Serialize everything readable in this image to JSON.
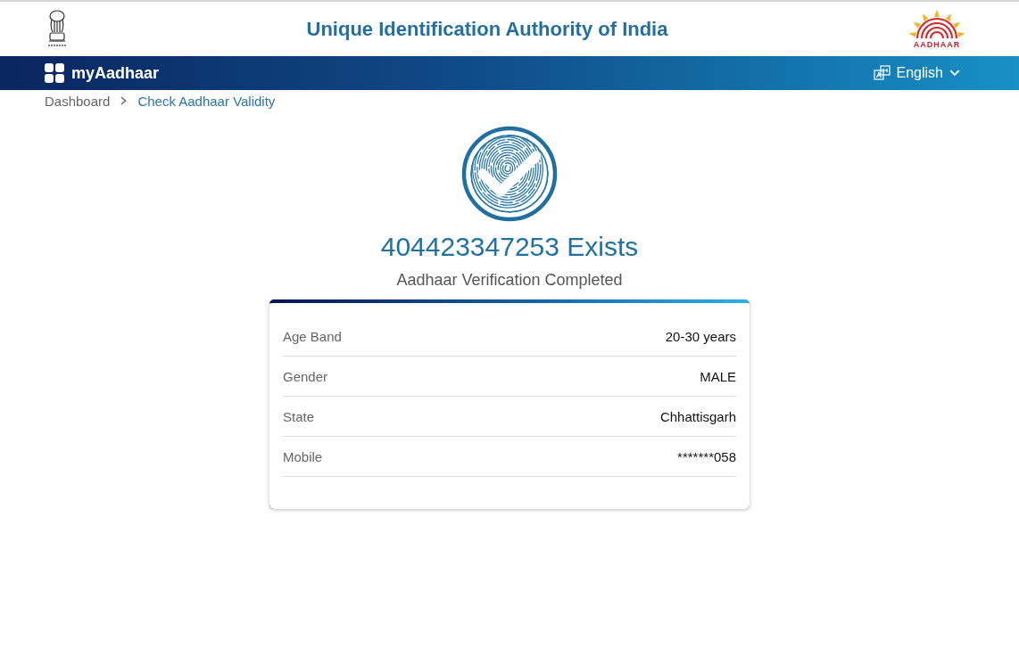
{
  "header": {
    "title": "Unique Identification Authority of India",
    "logo_text": "AADHAAR"
  },
  "navbar": {
    "brand": "myAadhaar",
    "language": "English"
  },
  "breadcrumb": [
    {
      "label": "Dashboard",
      "current": false
    },
    {
      "label": "Check Aadhaar Validity",
      "current": true
    }
  ],
  "result": {
    "heading": "404423347253 Exists",
    "subheading": "Aadhaar Verification Completed"
  },
  "details": [
    {
      "label": "Age Band",
      "value": "20-30 years"
    },
    {
      "label": "Gender",
      "value": "MALE"
    },
    {
      "label": "State",
      "value": "Chhattisgarh"
    },
    {
      "label": "Mobile",
      "value": "*******058"
    }
  ]
}
